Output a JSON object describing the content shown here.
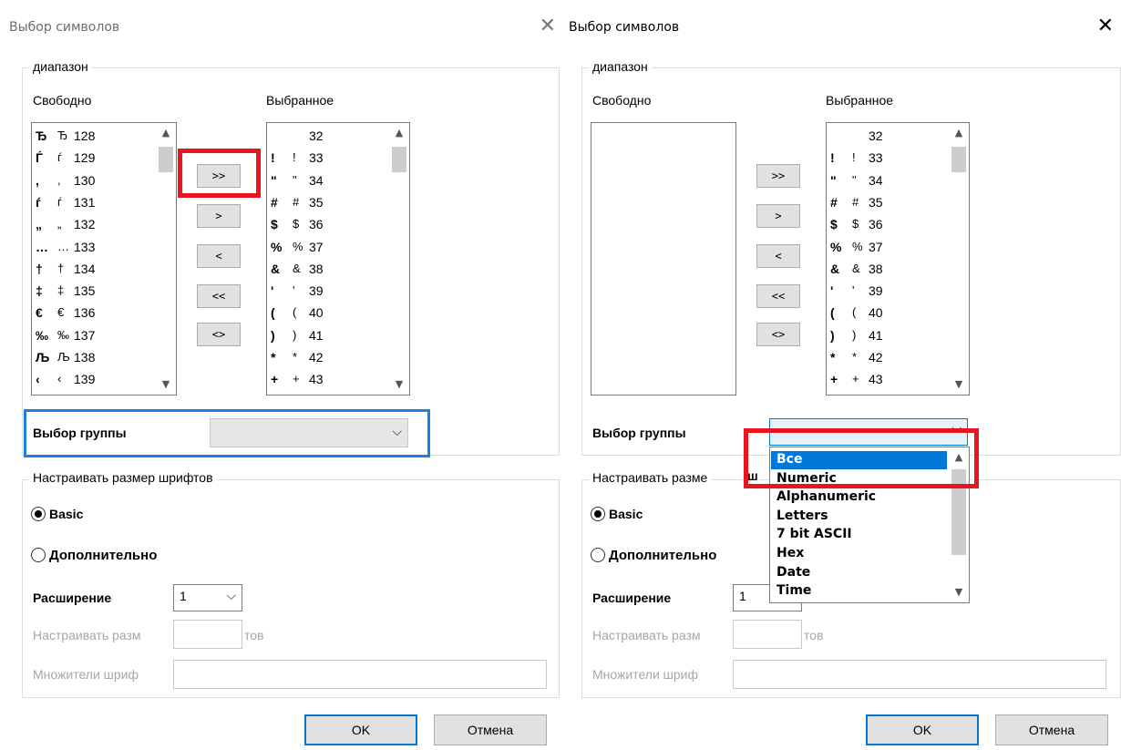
{
  "left": {
    "title": "Выбор символов",
    "close": "✕",
    "range_legend": "диапазон",
    "free_label": "Свободно",
    "selected_label": "Выбранное",
    "free_list": [
      {
        "g1": "Ђ",
        "g2": "Ђ",
        "code": "128"
      },
      {
        "g1": "Ѓ",
        "g2": "ѓ",
        "code": "129"
      },
      {
        "g1": ",",
        "g2": ",",
        "code": "130"
      },
      {
        "g1": "ѓ",
        "g2": "ѓ",
        "code": "131"
      },
      {
        "g1": "„",
        "g2": "„",
        "code": "132"
      },
      {
        "g1": "…",
        "g2": "…",
        "code": "133"
      },
      {
        "g1": "†",
        "g2": "†",
        "code": "134"
      },
      {
        "g1": "‡",
        "g2": "‡",
        "code": "135"
      },
      {
        "g1": "€",
        "g2": "€",
        "code": "136"
      },
      {
        "g1": "‰",
        "g2": "‰",
        "code": "137"
      },
      {
        "g1": "Љ",
        "g2": "Љ",
        "code": "138"
      },
      {
        "g1": "‹",
        "g2": "‹",
        "code": "139"
      }
    ],
    "selected_list": [
      {
        "g1": "",
        "g2": "",
        "code": "32"
      },
      {
        "g1": "!",
        "g2": "!",
        "code": "33"
      },
      {
        "g1": "\"",
        "g2": "\"",
        "code": "34"
      },
      {
        "g1": "#",
        "g2": "#",
        "code": "35"
      },
      {
        "g1": "$",
        "g2": "$",
        "code": "36"
      },
      {
        "g1": "%",
        "g2": "%",
        "code": "37"
      },
      {
        "g1": "&",
        "g2": "&",
        "code": "38"
      },
      {
        "g1": "'",
        "g2": "'",
        "code": "39"
      },
      {
        "g1": "(",
        "g2": "(",
        "code": "40"
      },
      {
        "g1": ")",
        "g2": ")",
        "code": "41"
      },
      {
        "g1": "*",
        "g2": "*",
        "code": "42"
      },
      {
        "g1": "+",
        "g2": "+",
        "code": "43"
      }
    ],
    "btn_all_right": ">>",
    "btn_right": ">",
    "btn_left": "<",
    "btn_all_left": "<<",
    "btn_swap": "<>",
    "group_label": "Выбор группы",
    "group_value": "",
    "font_size_legend": "Настраивать размер шрифтов",
    "radio_basic": "Basic",
    "radio_advanced": "Дополнительно",
    "expansion_label": "Расширение",
    "expansion_value": "1",
    "font_adjust_label": "Настраивать разм",
    "font_adjust_suffix": "тов",
    "font_mult_label": "Множители шриф",
    "ok": "OK",
    "cancel": "Отмена"
  },
  "right": {
    "title": "Выбор символов",
    "close": "✕",
    "range_legend": "диапазон",
    "free_label": "Свободно",
    "selected_label": "Выбранное",
    "selected_list": [
      {
        "g1": "",
        "g2": "",
        "code": "32"
      },
      {
        "g1": "!",
        "g2": "!",
        "code": "33"
      },
      {
        "g1": "\"",
        "g2": "\"",
        "code": "34"
      },
      {
        "g1": "#",
        "g2": "#",
        "code": "35"
      },
      {
        "g1": "$",
        "g2": "$",
        "code": "36"
      },
      {
        "g1": "%",
        "g2": "%",
        "code": "37"
      },
      {
        "g1": "&",
        "g2": "&",
        "code": "38"
      },
      {
        "g1": "'",
        "g2": "'",
        "code": "39"
      },
      {
        "g1": "(",
        "g2": "(",
        "code": "40"
      },
      {
        "g1": ")",
        "g2": ")",
        "code": "41"
      },
      {
        "g1": "*",
        "g2": "*",
        "code": "42"
      },
      {
        "g1": "+",
        "g2": "+",
        "code": "43"
      }
    ],
    "btn_all_right": ">>",
    "btn_right": ">",
    "btn_left": "<",
    "btn_all_left": "<<",
    "btn_swap": "<>",
    "group_label": "Выбор группы",
    "group_options": [
      "Все",
      "Numeric",
      "Alphanumeric",
      "Letters",
      "7 bit ASCII",
      "Hex",
      "Date",
      "Time"
    ],
    "group_selected": "Все",
    "font_size_legend": "Настраивать разме",
    "font_size_legend_tail": "ш",
    "radio_basic": "Basic",
    "radio_advanced": "Дополнительно",
    "expansion_label": "Расширение",
    "expansion_value": "1",
    "font_adjust_label": "Настраивать разм",
    "font_adjust_suffix": "тов",
    "font_mult_label": "Множители шриф",
    "ok": "OK",
    "cancel": "Отмена"
  },
  "colors": {
    "highlight_red": "#e8141e",
    "highlight_blue": "#1e7fe3",
    "selection": "#0078d7"
  }
}
